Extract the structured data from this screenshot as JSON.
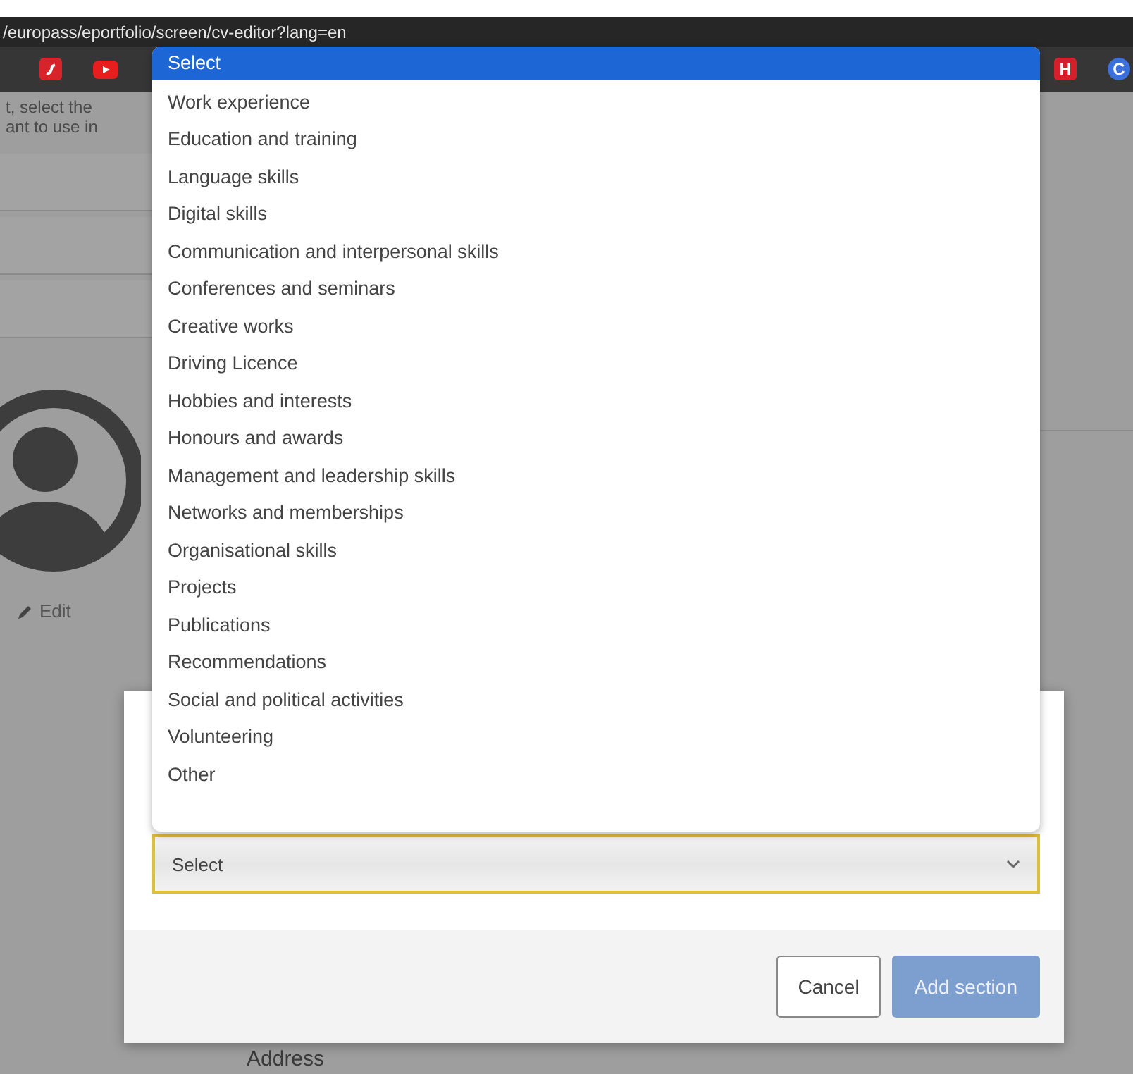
{
  "browser": {
    "url": "/europass/eportfolio/screen/cv-editor?lang=en",
    "extension_badges": [
      {
        "letter": "H",
        "color": "#d3202b"
      },
      {
        "letter": "C",
        "color": "#3b6fd9"
      }
    ]
  },
  "page": {
    "intro_lines": [
      "t, select the",
      "ant to use in"
    ],
    "edit_link": "Edit",
    "address_label": "Address"
  },
  "modal": {
    "select": {
      "value": "Select"
    },
    "buttons": [
      {
        "label": "Cancel",
        "kind": "secondary",
        "disabled": false
      },
      {
        "label": "Add section",
        "kind": "primary",
        "disabled": true
      }
    ]
  },
  "dropdown": {
    "options": [
      {
        "label": "Select",
        "selected": true
      },
      {
        "label": "Work experience",
        "selected": false
      },
      {
        "label": "Education and training",
        "selected": false
      },
      {
        "label": "Language skills",
        "selected": false
      },
      {
        "label": "Digital skills",
        "selected": false
      },
      {
        "label": "Communication and interpersonal skills",
        "selected": false
      },
      {
        "label": "Conferences and seminars",
        "selected": false
      },
      {
        "label": "Creative works",
        "selected": false
      },
      {
        "label": "Driving Licence",
        "selected": false
      },
      {
        "label": "Hobbies and interests",
        "selected": false
      },
      {
        "label": "Honours and awards",
        "selected": false
      },
      {
        "label": "Management and leadership skills",
        "selected": false
      },
      {
        "label": "Networks and memberships",
        "selected": false
      },
      {
        "label": "Organisational skills",
        "selected": false
      },
      {
        "label": "Projects",
        "selected": false
      },
      {
        "label": "Publications",
        "selected": false
      },
      {
        "label": "Recommendations",
        "selected": false
      },
      {
        "label": "Social and political activities",
        "selected": false
      },
      {
        "label": "Volunteering",
        "selected": false
      },
      {
        "label": "Other",
        "selected": false
      }
    ]
  }
}
